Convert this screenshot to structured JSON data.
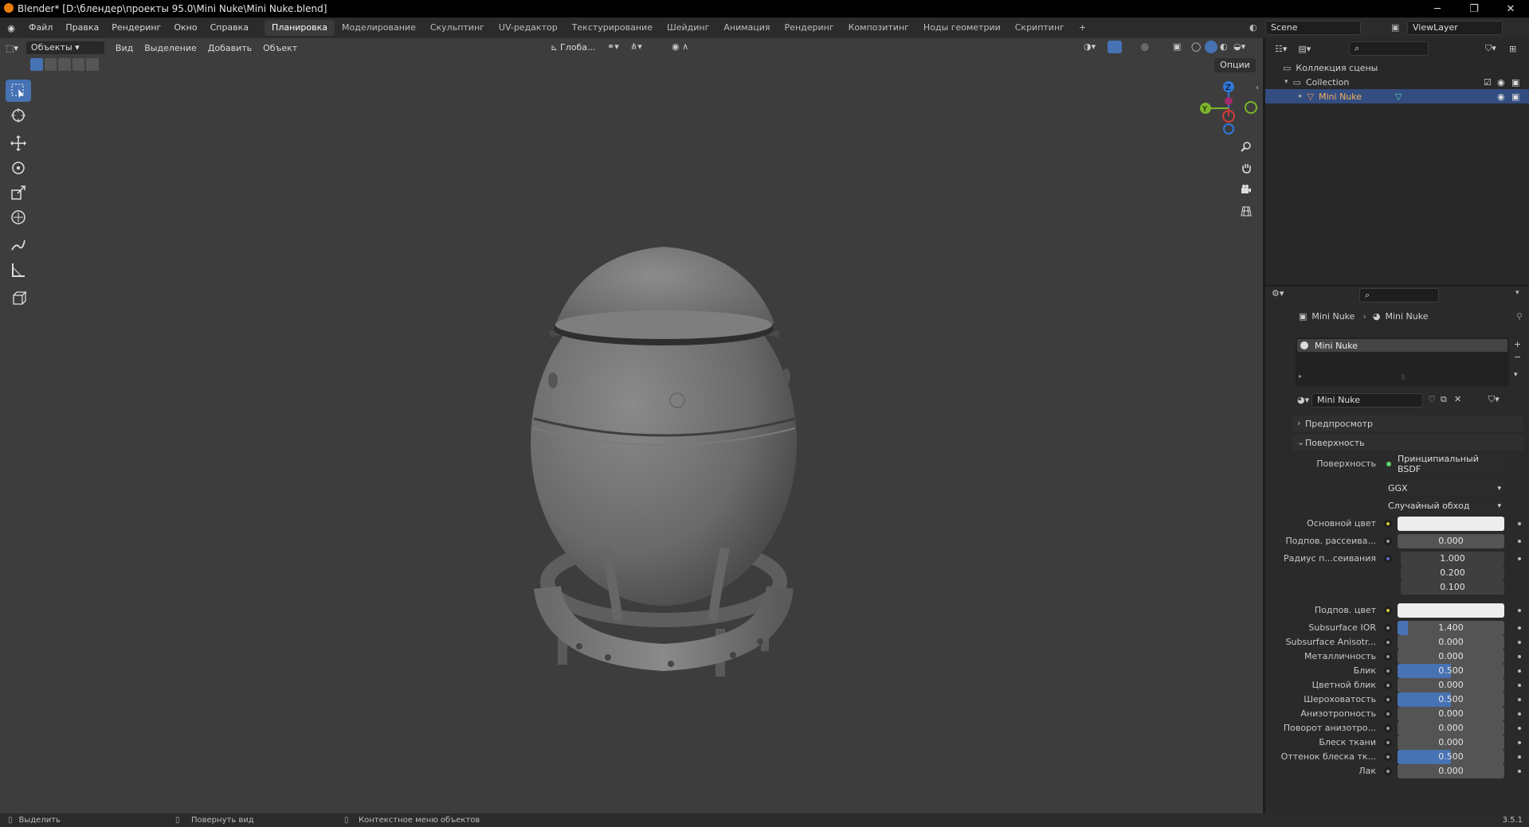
{
  "window": {
    "title": "Blender* [D:\\блендер\\проекты 95.0\\Mini Nuke\\Mini Nuke.blend]",
    "controls": [
      "─",
      "❐",
      "✕"
    ]
  },
  "menu": [
    "Файл",
    "Правка",
    "Рендеринг",
    "Окно",
    "Справка"
  ],
  "workspaces": [
    "Планировка",
    "Моделирование",
    "Скульптинг",
    "UV-редактор",
    "Текстурирование",
    "Шейдинг",
    "Анимация",
    "Рендеринг",
    "Композитинг",
    "Ноды геометрии",
    "Скриптинг"
  ],
  "active_workspace": "Планировка",
  "scene": {
    "name": "Scene",
    "view_layer": "ViewLayer"
  },
  "viewport_header": {
    "mode": "Объекты",
    "menus": [
      "Вид",
      "Выделение",
      "Добавить",
      "Объект"
    ],
    "orientation": "Глоба...",
    "options": "Опции"
  },
  "gizmo": {
    "z": "Z",
    "y": "Y"
  },
  "outliner": {
    "scene_collection": "Коллекция сцены",
    "collection": "Collection",
    "object": "Mini Nuke"
  },
  "properties": {
    "breadcrumb_object": "Mini Nuke",
    "breadcrumb_material": "Mini Nuke",
    "slot": "Mini Nuke",
    "material_name": "Mini Nuke",
    "panel_preview": "Предпросмотр",
    "panel_surface": "Поверхность",
    "surface_label": "Поверхность",
    "surface_value": "Принципиальный BSDF",
    "distribution": "GGX",
    "subsurface_method": "Случайный обход",
    "rows": [
      {
        "label": "Основной цвет",
        "type": "color",
        "color": "#ededed"
      },
      {
        "label": "Подпов. рассеива...",
        "value": "0.000",
        "fill": 0
      },
      {
        "label": "Радиус п...сеивания",
        "vector": [
          "1.000",
          "0.200",
          "0.100"
        ]
      },
      {
        "label": "Подпов. цвет",
        "type": "color",
        "color": "#ededed"
      },
      {
        "label": "Subsurface IOR",
        "value": "1.400",
        "fill": 0.1
      },
      {
        "label": "Subsurface Anisotr...",
        "value": "0.000",
        "fill": 0
      },
      {
        "label": "Металличность",
        "value": "0.000",
        "fill": 0
      },
      {
        "label": "Блик",
        "value": "0.500",
        "fill": 0.5
      },
      {
        "label": "Цветной блик",
        "value": "0.000",
        "fill": 0
      },
      {
        "label": "Шероховатость",
        "value": "0.500",
        "fill": 0.5
      },
      {
        "label": "Анизотропность",
        "value": "0.000",
        "fill": 0
      },
      {
        "label": "Поворот анизотро...",
        "value": "0.000",
        "fill": 0
      },
      {
        "label": "Блеск ткани",
        "value": "0.000",
        "fill": 0
      },
      {
        "label": "Оттенок блеска тк...",
        "value": "0.500",
        "fill": 0.5
      },
      {
        "label": "Лак",
        "value": "0.000",
        "fill": 0
      }
    ]
  },
  "status": {
    "select": "Выделить",
    "rotate": "Повернуть вид",
    "context": "Контекстное меню объектов",
    "version": "3.5.1"
  },
  "colors": {
    "accent": "#4772b3",
    "viewport": "#3d3d3d",
    "selected_row": "#334d80"
  }
}
